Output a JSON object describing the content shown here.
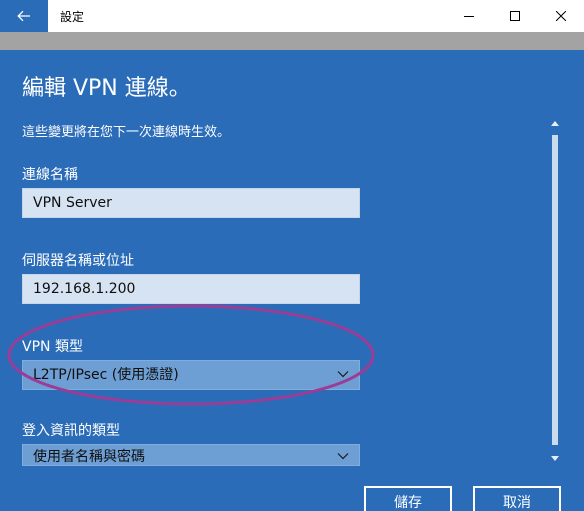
{
  "window": {
    "title": "設定"
  },
  "dialog": {
    "title": "編輯 VPN 連線。",
    "hint": "這些變更將在您下一次連線時生效。",
    "connection_name": {
      "label": "連線名稱",
      "value": "VPN Server"
    },
    "server": {
      "label": "伺服器名稱或位址",
      "value": "192.168.1.200"
    },
    "vpn_type": {
      "label": "VPN 類型",
      "value": "L2TP/IPsec (使用憑證)"
    },
    "signin_type": {
      "label": "登入資訊的類型",
      "value": "使用者名稱與密碼"
    },
    "buttons": {
      "save": "儲存",
      "cancel": "取消"
    }
  },
  "colors": {
    "accent": "#2b6cb8",
    "band": "#a3a3a3",
    "annotation": "#9b3d96"
  }
}
